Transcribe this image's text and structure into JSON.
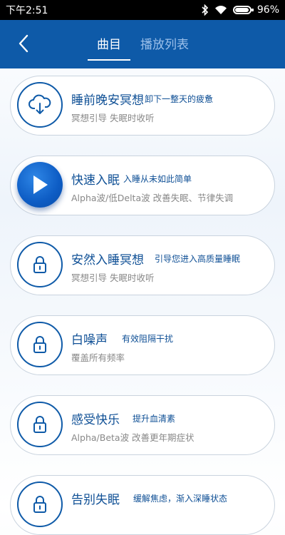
{
  "status": {
    "time": "下午2:51",
    "battery": "96%"
  },
  "header": {
    "tabs": [
      "曲目",
      "播放列表"
    ]
  },
  "tracks": [
    {
      "title": "睡前晚安冥想",
      "subtitle": "卸下一整天的疲惫",
      "desc": "冥想引导  失眠时收听",
      "icon": "download-cloud-icon"
    },
    {
      "title": "快速入眠",
      "subtitle": "入睡从未如此简单",
      "desc": "Alpha波/低Delta波  改善失眠、节律失调",
      "icon": "play-icon"
    },
    {
      "title": "安然入睡冥想",
      "subtitle": "引导您进入高质量睡眠",
      "desc": "冥想引导  失眠时收听",
      "icon": "lock-icon"
    },
    {
      "title": "白噪声",
      "subtitle": "有效阻隔干扰",
      "desc": "覆盖所有频率",
      "icon": "lock-icon"
    },
    {
      "title": "感受快乐",
      "subtitle": "提升血清素",
      "desc": "Alpha/Beta波  改善更年期症状",
      "icon": "lock-icon"
    },
    {
      "title": "告别失眠",
      "subtitle": "缓解焦虑，渐入深睡状态",
      "desc": "",
      "icon": "lock-icon"
    }
  ]
}
